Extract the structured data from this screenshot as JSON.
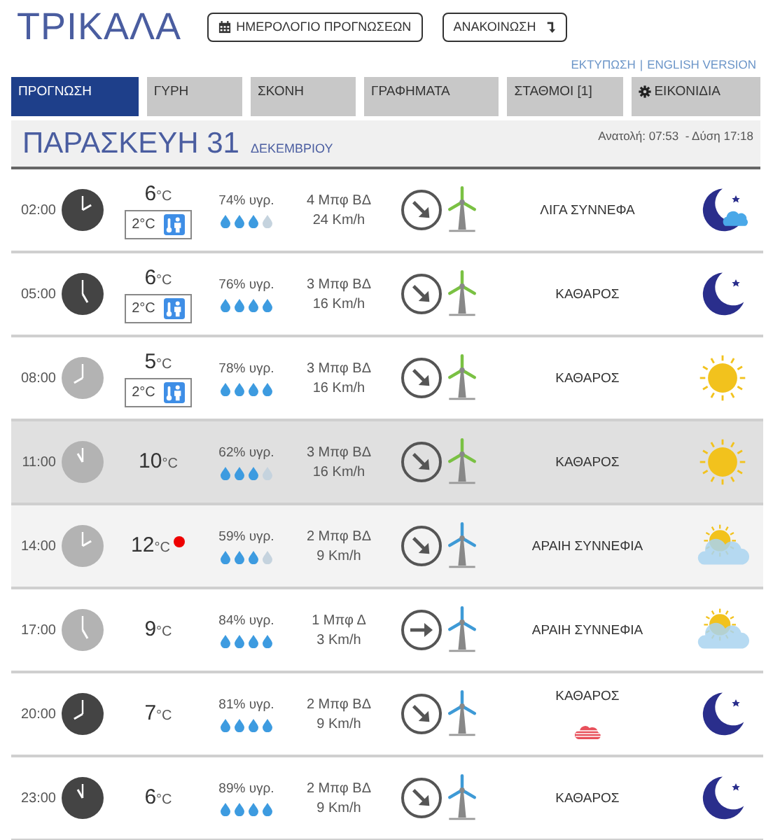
{
  "city": "ΤΡΙΚΑΛΑ",
  "header_buttons": [
    "ΗΜΕΡΟΛΟΓΙΟ ΠΡΟΓΝΩΣΕΩΝ",
    "ΑΝΑΚΟΙΝΩΣΗ"
  ],
  "links": [
    "ΕΚΤΥΠΩΣΗ",
    "ENGLISH VERSION"
  ],
  "link_separator": "|",
  "tabs": [
    {
      "label": "ΠΡΟΓΝΩΣΗ",
      "selected": true
    },
    {
      "label": "ΓΥΡΗ",
      "selected": false
    },
    {
      "label": "ΣΚΟΝΗ",
      "selected": false
    },
    {
      "label": "ΓΡΑΦΗΜΑΤΑ",
      "selected": false
    },
    {
      "label": "ΣΤΑΘΜΟΙ [1]",
      "selected": false
    },
    {
      "label": "ΕΙΚΟΝΙΔΙΑ",
      "selected": false
    }
  ],
  "day": {
    "title": "ΠΑΡΑΣΚΕΥΗ 31",
    "month": "ΔΕΚΕΜΒΡΙΟΥ",
    "sun": "Ανατολή: 07:53  - Δύση 17:18"
  },
  "rows": [
    {
      "time": "02:00",
      "daytime": false,
      "temp": "6",
      "unit": "°C",
      "feels_like": "2°C",
      "humidity": "74% υγρ.",
      "stars": 3,
      "wind": {
        "force": "4 Μπφ ΒΔ",
        "speed": "24 Km/h",
        "kind": "southeast"
      },
      "color": "#7ac143",
      "condition": "ΛΙΓΑ ΣΥΝΝΕΦΑ",
      "kind": "moon-cloud"
    },
    {
      "time": "05:00",
      "daytime": false,
      "temp": "6",
      "unit": "°C",
      "feels_like": "2°C",
      "humidity": "76% υγρ.",
      "stars": 4,
      "wind": {
        "force": "3 Μπφ ΒΔ",
        "speed": "16 Km/h",
        "kind": "southeast"
      },
      "color": "#7ac143",
      "condition": "ΚΑΘΑΡΟΣ",
      "kind": "moon"
    },
    {
      "time": "08:00",
      "daytime": true,
      "temp": "5",
      "unit": "°C",
      "feels_like": "2°C",
      "humidity": "78% υγρ.",
      "stars": 4,
      "wind": {
        "force": "3 Μπφ ΒΔ",
        "speed": "16 Km/h",
        "kind": "southeast"
      },
      "color": "#7ac143",
      "condition": "ΚΑΘΑΡΟΣ",
      "kind": "sun"
    },
    {
      "time": "11:00",
      "daytime": true,
      "current": true,
      "temp": "10",
      "unit": "°C",
      "humidity": "62% υγρ.",
      "stars": 3,
      "wind": {
        "force": "3 Μπφ ΒΔ",
        "speed": "16 Km/h",
        "kind": "southeast"
      },
      "color": "#7ac143",
      "condition": "ΚΑΘΑΡΟΣ",
      "kind": "sun"
    },
    {
      "time": "14:00",
      "daytime": true,
      "highlighted": true,
      "temp": "12",
      "unit": "°C",
      "alert": true,
      "humidity": "59% υγρ.",
      "stars": 3,
      "wind": {
        "force": "2 Μπφ ΒΔ",
        "speed": "9 Km/h",
        "kind": "southeast"
      },
      "color": "#3e9ad6",
      "condition": "ΑΡΑΙΗ ΣΥΝΝΕΦΙΑ",
      "kind": "sun-cloud"
    },
    {
      "time": "17:00",
      "daytime": true,
      "temp": "9",
      "unit": "°C",
      "humidity": "84% υγρ.",
      "stars": 4,
      "wind": {
        "force": "1 Μπφ Δ",
        "speed": "3 Km/h",
        "kind": "east"
      },
      "color": "#3e9ad6",
      "condition": "ΑΡΑΙΗ ΣΥΝΝΕΦΙΑ",
      "kind": "sun-cloud"
    },
    {
      "time": "20:00",
      "daytime": false,
      "temp": "7",
      "unit": "°C",
      "humidity": "81% υγρ.",
      "stars": 4,
      "wind": {
        "force": "2 Μπφ ΒΔ",
        "speed": "9 Km/h",
        "kind": "southeast"
      },
      "color": "#3e9ad6",
      "condition": "ΚΑΘΑΡΟΣ",
      "warning": true,
      "kind": "moon"
    },
    {
      "time": "23:00",
      "daytime": false,
      "temp": "6",
      "unit": "°C",
      "humidity": "89% υγρ.",
      "stars": 4,
      "wind": {
        "force": "2 Μπφ ΒΔ",
        "speed": "9 Km/h",
        "kind": "southeast"
      },
      "color": "#3e9ad6",
      "condition": "ΚΑΘΑΡΟΣ",
      "kind": "moon"
    }
  ]
}
